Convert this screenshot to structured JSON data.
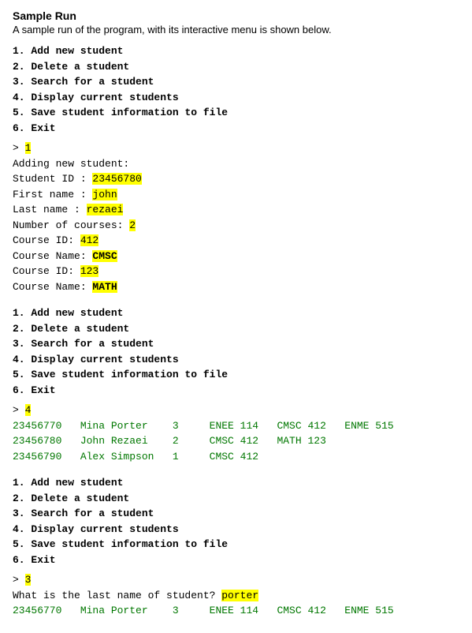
{
  "title": "Sample Run",
  "description": "A sample run of the program, with its interactive menu is shown below.",
  "menu": {
    "items": [
      "1.  Add new student",
      "2.  Delete a student",
      "3.  Search for a student",
      "4.  Display current students",
      "5.  Save student information to file",
      "6.  Exit"
    ]
  },
  "block1": {
    "prompt": "> 1",
    "lines": [
      "Adding new student:",
      "Student ID : ",
      "First name : ",
      "Last name : ",
      "Number of courses: ",
      "Course ID: ",
      "Course Name: ",
      "Course ID: ",
      "Course Name: "
    ],
    "values": {
      "student_id": "23456780",
      "first_name": "john",
      "last_name": "rezaei",
      "num_courses": "2",
      "course_id1": "412",
      "course_name1": "CMSC",
      "course_id2": "123",
      "course_name2": "MATH"
    }
  },
  "block2": {
    "prompt": "> 4",
    "students": [
      {
        "id": "23456770",
        "name": "Mina Porter  ",
        "courses": "3    ENEE 114   CMSC 412   ENME 515"
      },
      {
        "id": "23456780",
        "name": "John Rezaei  ",
        "courses": "2    CMSC 412   MATH 123"
      },
      {
        "id": "23456790",
        "name": "Alex Simpson ",
        "courses": "1    CMSC 412"
      }
    ]
  },
  "block3": {
    "prompt": "> 3",
    "question": "What is the last name of student? ",
    "search_value": "porter",
    "result": "23456770   Mina Porter    3    ENEE 114   CMSC 412   ENME 515"
  }
}
